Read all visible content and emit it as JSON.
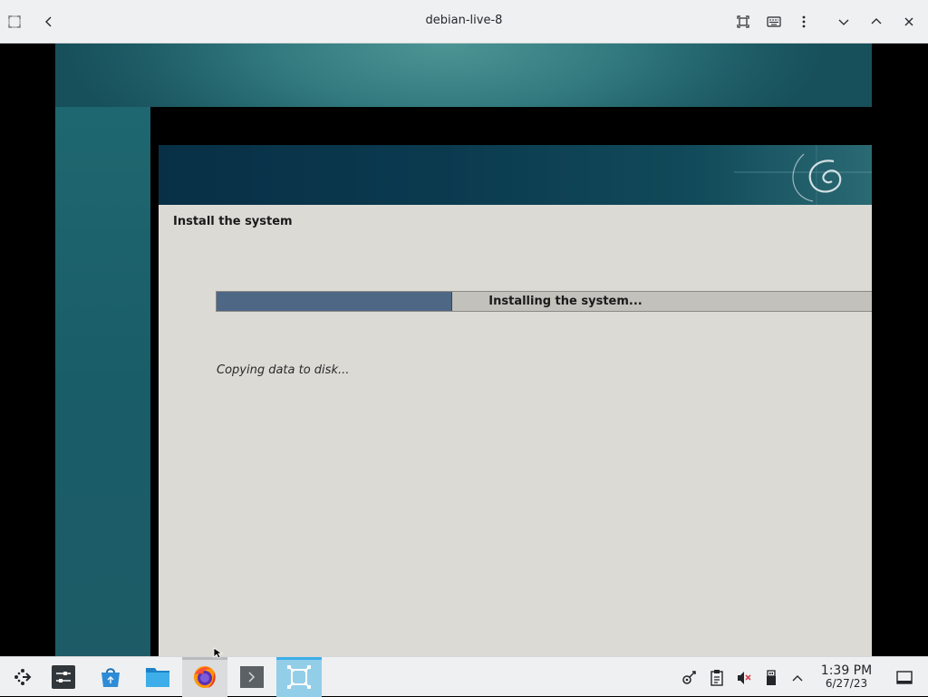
{
  "window": {
    "title": "debian-live-8"
  },
  "installer": {
    "step_title": "Install the system",
    "progress_label": "Installing the system...",
    "progress_fraction": 0.36,
    "status_text": "Copying data to disk..."
  },
  "taskbar": {
    "apps": [
      "application-launcher-icon",
      "system-settings-icon",
      "discover-store-icon",
      "file-manager-icon",
      "firefox-icon",
      "terminal-icon",
      "virt-viewer-icon"
    ],
    "clock_time": "1:39 PM",
    "clock_date": "6/27/23"
  },
  "colors": {
    "titlebar_bg": "#eff0f1",
    "progress_fill": "#4d6785",
    "installer_bg": "#dcdad5",
    "active_task": "#93cee9"
  }
}
